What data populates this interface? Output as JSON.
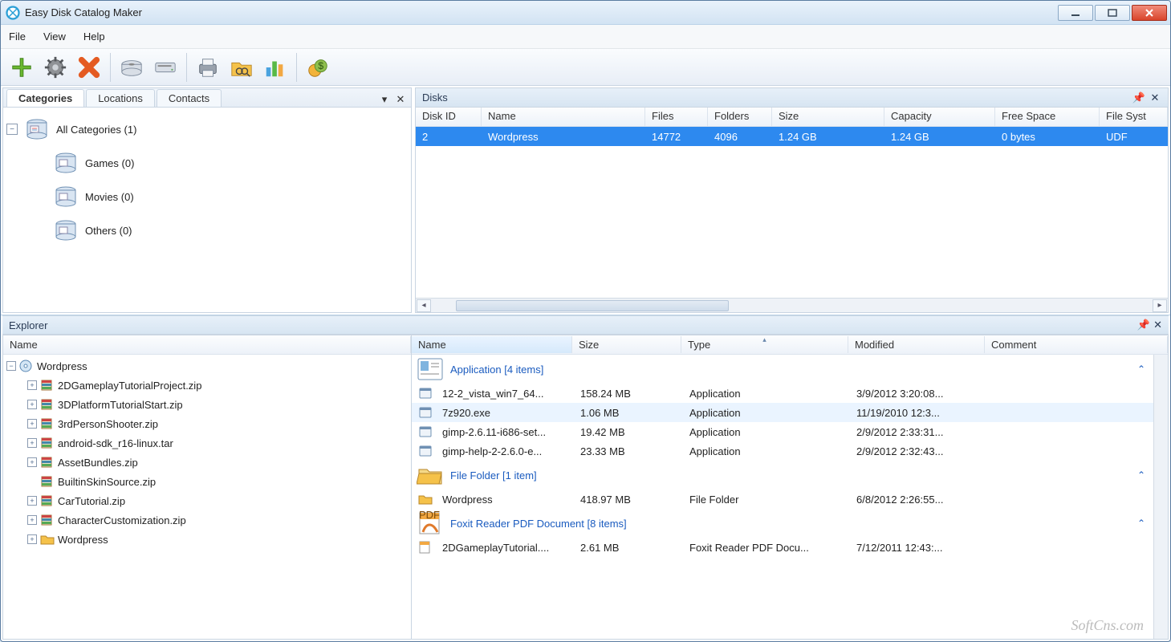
{
  "window": {
    "title": "Easy Disk Catalog Maker"
  },
  "menu": [
    "File",
    "View",
    "Help"
  ],
  "tabs": {
    "categories": "Categories",
    "locations": "Locations",
    "contacts": "Contacts"
  },
  "tree": {
    "root": "All Categories (1)",
    "children": [
      "Games (0)",
      "Movies (0)",
      "Others (0)"
    ]
  },
  "disks": {
    "title": "Disks",
    "columns": [
      "Disk ID",
      "Name",
      "Files",
      "Folders",
      "Size",
      "Capacity",
      "Free Space",
      "File Syst"
    ],
    "row": {
      "id": "2",
      "name": "Wordpress",
      "files": "14772",
      "folders": "4096",
      "size": "1.24 GB",
      "capacity": "1.24 GB",
      "free": "0 bytes",
      "fs": "UDF"
    }
  },
  "explorer": {
    "title": "Explorer",
    "left_header": "Name",
    "root": "Wordpress",
    "files": [
      "2DGameplayTutorialProject.zip",
      "3DPlatformTutorialStart.zip",
      "3rdPersonShooter.zip",
      "android-sdk_r16-linux.tar",
      "AssetBundles.zip",
      "BuiltinSkinSource.zip",
      "CarTutorial.zip",
      "CharacterCustomization.zip"
    ],
    "folder": "Wordpress",
    "right_columns": [
      "Name",
      "Size",
      "Type",
      "Modified",
      "Comment"
    ],
    "groups": {
      "application": {
        "label": "Application [4 items]",
        "rows": [
          {
            "name": "12-2_vista_win7_64...",
            "size": "158.24 MB",
            "type": "Application",
            "mod": "3/9/2012 3:20:08..."
          },
          {
            "name": "7z920.exe",
            "size": "1.06 MB",
            "type": "Application",
            "mod": "11/19/2010 12:3..."
          },
          {
            "name": "gimp-2.6.11-i686-set...",
            "size": "19.42 MB",
            "type": "Application",
            "mod": "2/9/2012 2:33:31..."
          },
          {
            "name": "gimp-help-2-2.6.0-e...",
            "size": "23.33 MB",
            "type": "Application",
            "mod": "2/9/2012 2:32:43..."
          }
        ]
      },
      "folder": {
        "label": "File Folder [1 item]",
        "rows": [
          {
            "name": "Wordpress",
            "size": "418.97 MB",
            "type": "File Folder",
            "mod": "6/8/2012 2:26:55..."
          }
        ]
      },
      "pdf": {
        "label": "Foxit Reader PDF Document [8 items]",
        "rows": [
          {
            "name": "2DGameplayTutorial....",
            "size": "2.61 MB",
            "type": "Foxit Reader PDF Docu...",
            "mod": "7/12/2011 12:43:..."
          }
        ]
      }
    }
  },
  "watermark": "SoftCns.com"
}
